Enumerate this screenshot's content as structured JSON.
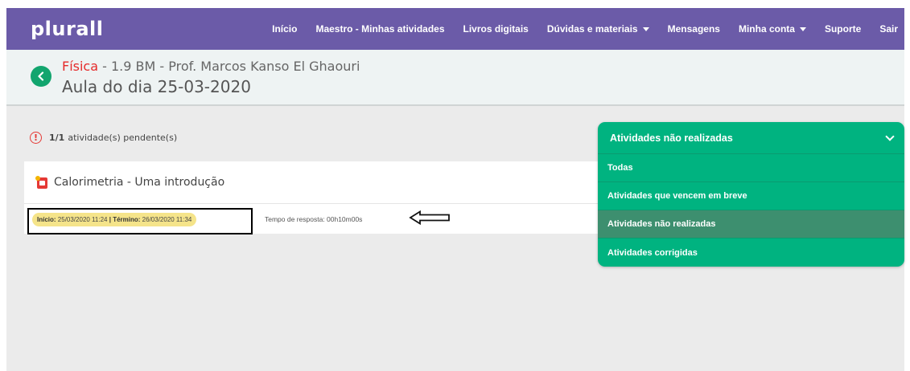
{
  "app": {
    "logo": "plurall"
  },
  "nav": {
    "items": [
      {
        "label": "Início",
        "has_caret": false
      },
      {
        "label": "Maestro - Minhas atividades",
        "has_caret": false
      },
      {
        "label": "Livros digitais",
        "has_caret": false
      },
      {
        "label": "Dúvidas e materiais",
        "has_caret": true
      },
      {
        "label": "Mensagens",
        "has_caret": false
      },
      {
        "label": "Minha conta",
        "has_caret": true
      },
      {
        "label": "Suporte",
        "has_caret": false
      },
      {
        "label": "Sair",
        "has_caret": false
      }
    ]
  },
  "header": {
    "subject": "Física",
    "crumb_rest": " - 1.9 BM - Prof. Marcos Kanso El Ghaouri",
    "title": "Aula do dia 25-03-2020"
  },
  "pending": {
    "count": "1/1",
    "label": "atividade(s) pendente(s)"
  },
  "activity": {
    "title": "Calorimetria - Uma introdução",
    "start_label": "Início:",
    "start_value": "25/03/2020 11:24",
    "separator": "|",
    "end_label": "Término:",
    "end_value": "26/03/2020 11:34",
    "response_time": "Tempo de resposta: 00h10m00s"
  },
  "filter": {
    "selected": "Atividades não realizadas",
    "options": [
      {
        "label": "Todas",
        "active": false
      },
      {
        "label": "Atividades que vencem em breve",
        "active": false
      },
      {
        "label": "Atividades não realizadas",
        "active": true
      },
      {
        "label": "Atividades corrigidas",
        "active": false
      }
    ]
  },
  "colors": {
    "nav": "#6b5ba8",
    "subject": "#e52a2a",
    "accent_green": "#00b380",
    "active_item": "#3d8f6f",
    "date_badge": "#f5e48a"
  },
  "icons": {
    "back": "chevron-left-icon",
    "alert": "alert-circle-icon",
    "activity": "activity-icon",
    "arrow": "arrow-left-icon",
    "dropdown": "chevron-down-icon"
  }
}
